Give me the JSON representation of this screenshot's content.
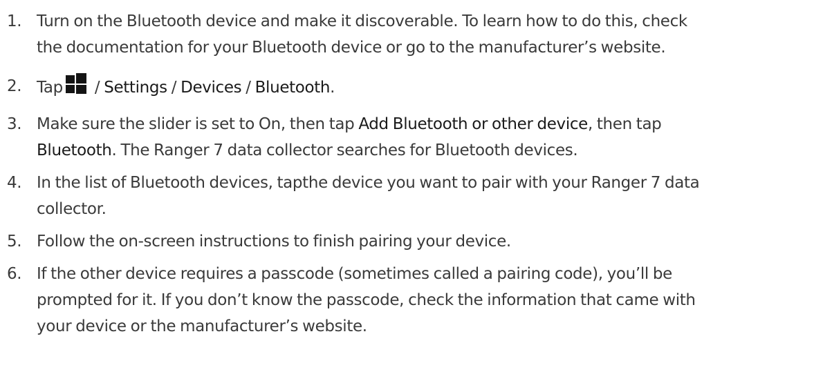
{
  "steps": [
    {
      "number": "1.",
      "line1": "Turn on the Bluetooth device and make it discoverable. To learn how to do this, check",
      "line2": "the documentation for your Bluetooth device or go to the manufacturer’s website."
    },
    {
      "number": "2.",
      "prefix": "Tap",
      "icon": "windows-start-icon",
      "sep1": " / ",
      "settings": "Settings",
      "sep2": " / ",
      "devices": "Devices",
      "sep3": " / ",
      "bluetooth": "Bluetooth",
      "end": "."
    },
    {
      "number": "3.",
      "text1": "Make sure the slider is set to On, then tap ",
      "add_device": "Add Bluetooth or other device",
      "text2": ", then tap",
      "bluetooth": "Bluetooth",
      "text3": ". The Ranger 7 data collector searches for Bluetooth devices."
    },
    {
      "number": "4.",
      "line1": "In the list of Bluetooth devices, tapthe device you want to pair with your Ranger 7 data",
      "line2": "collector."
    },
    {
      "number": "5.",
      "line1": "Follow the on-screen instructions to finish pairing your device."
    },
    {
      "number": "6.",
      "line1": "If the other device requires a passcode (sometimes called a pairing code), you’ll be",
      "line2": "prompted for it. If you don’t know the passcode, check the information that came with",
      "line3": "your device or the manufacturer’s website."
    }
  ]
}
